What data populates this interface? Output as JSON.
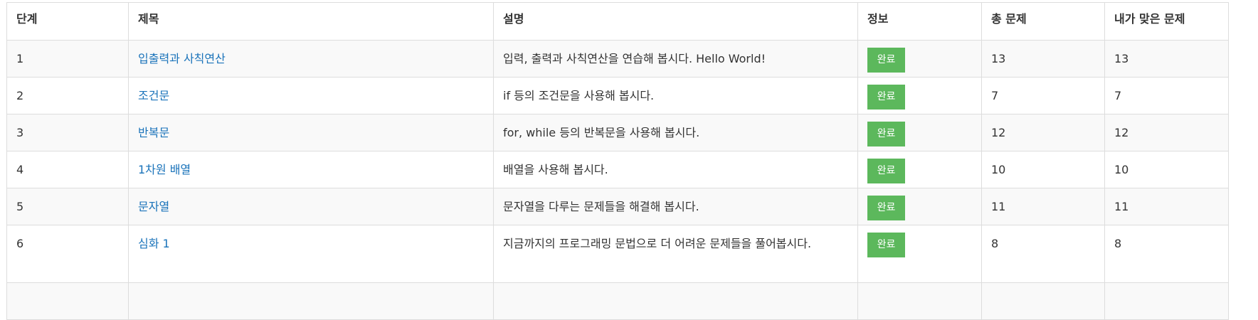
{
  "headers": [
    "단계",
    "제목",
    "설명",
    "정보",
    "총 문제",
    "내가 맞은 문제"
  ],
  "rows": [
    {
      "step": "1",
      "title": "입출력과 사칙연산",
      "desc": "입력, 출력과 사칙연산을 연습해 봅시다. Hello World!",
      "status": "완료",
      "total": "13",
      "solved": "13"
    },
    {
      "step": "2",
      "title": "조건문",
      "desc": "if 등의 조건문을 사용해 봅시다.",
      "status": "완료",
      "total": "7",
      "solved": "7"
    },
    {
      "step": "3",
      "title": "반복문",
      "desc": "for, while 등의 반복문을 사용해 봅시다.",
      "status": "완료",
      "total": "12",
      "solved": "12"
    },
    {
      "step": "4",
      "title": "1차원 배열",
      "desc": "배열을 사용해 봅시다.",
      "status": "완료",
      "total": "10",
      "solved": "10"
    },
    {
      "step": "5",
      "title": "문자열",
      "desc": "문자열을 다루는 문제들을 해결해 봅시다.",
      "status": "완료",
      "total": "11",
      "solved": "11"
    },
    {
      "step": "6",
      "title": "심화 1",
      "desc": "지금까지의 프로그래밍 문법으로 더 어려운 문제들을 풀어봅시다.",
      "status": "완료",
      "total": "8",
      "solved": "8"
    }
  ],
  "colors": {
    "badge": "#5cb85c",
    "link": "#1a73ba",
    "stripe": "#f9f9f9"
  }
}
